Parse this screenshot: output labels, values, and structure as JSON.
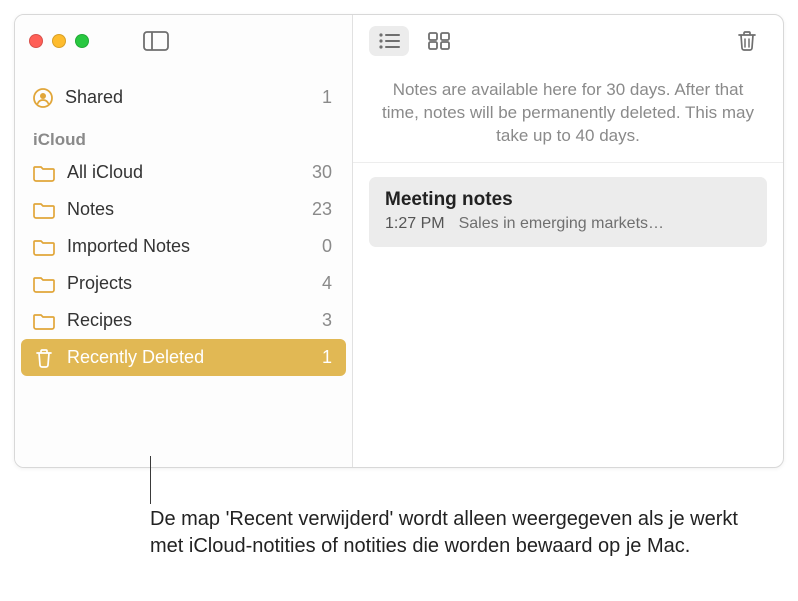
{
  "sidebar": {
    "shared": {
      "label": "Shared",
      "count": "1"
    },
    "section": "iCloud",
    "folders": [
      {
        "label": "All iCloud",
        "count": "30",
        "icon": "folder"
      },
      {
        "label": "Notes",
        "count": "23",
        "icon": "folder"
      },
      {
        "label": "Imported Notes",
        "count": "0",
        "icon": "folder"
      },
      {
        "label": "Projects",
        "count": "4",
        "icon": "folder"
      },
      {
        "label": "Recipes",
        "count": "3",
        "icon": "folder"
      },
      {
        "label": "Recently Deleted",
        "count": "1",
        "icon": "trash",
        "selected": true
      }
    ]
  },
  "banner": "Notes are available here for 30 days. After that time, notes will be permanently deleted. This may take up to 40 days.",
  "note": {
    "title": "Meeting notes",
    "time": "1:27 PM",
    "preview": "Sales in emerging markets…"
  },
  "callout": "De map 'Recent verwijderd' wordt alleen weergegeven als je werkt met iCloud-notities of notities die worden bewaard op je Mac."
}
